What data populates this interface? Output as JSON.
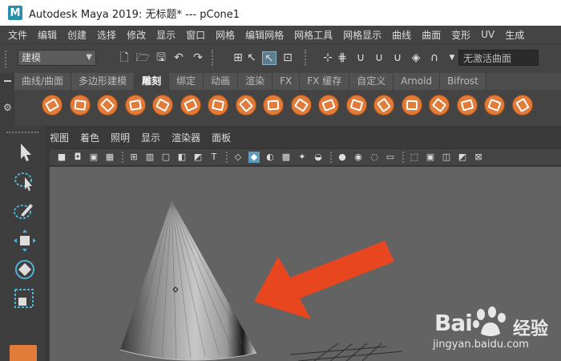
{
  "titlebar": {
    "logo": "M",
    "title": "Autodesk Maya 2019: 无标题*   ---   pCone1"
  },
  "menubar": {
    "items": [
      "文件",
      "编辑",
      "创建",
      "选择",
      "修改",
      "显示",
      "窗口",
      "网格",
      "编辑网格",
      "网格工具",
      "网格显示",
      "曲线",
      "曲面",
      "变形",
      "UV",
      "生成"
    ]
  },
  "statusline": {
    "mode": "建模",
    "live_surface": "无激活曲面",
    "icons": [
      "new-scene-icon",
      "open-scene-icon",
      "save-scene-icon",
      "undo-icon",
      "redo-icon",
      "select-by-hierarchy-icon",
      "select-by-object-icon",
      "select-by-component-icon",
      "snap-to-grid-icon",
      "snap-to-curve-icon",
      "snap-to-point-icon",
      "snap-to-projected-center-icon",
      "snap-to-view-plane-icon",
      "make-live-icon"
    ]
  },
  "shelf": {
    "tabs": [
      "曲线/曲面",
      "多边形建模",
      "雕刻",
      "绑定",
      "动画",
      "渲染",
      "FX",
      "FX 缓存",
      "自定义",
      "Arnold",
      "Bifrost"
    ],
    "active_tab": "雕刻",
    "tool_count_label": "",
    "tools": [
      "sculpt-tool",
      "smooth-tool",
      "relax-tool",
      "grab-tool",
      "pinch-tool",
      "flatten-tool",
      "foamy-tool",
      "spray-tool",
      "repeat-tool",
      "imprint-tool",
      "wax-tool",
      "scrape-tool",
      "fill-tool",
      "knife-tool",
      "smear-tool",
      "bulge-tool",
      "amplify-tool",
      "freeze-tool"
    ]
  },
  "toolbox": {
    "tools": [
      "select-tool-icon",
      "lasso-tool-icon",
      "paint-select-tool-icon",
      "move-tool-icon",
      "rotate-tool-icon",
      "scale-tool-icon"
    ]
  },
  "panel": {
    "menu": [
      "视图",
      "着色",
      "照明",
      "显示",
      "渲染器",
      "面板"
    ]
  },
  "watermark": {
    "brand": "Bai",
    "brand_suffix": "经验",
    "url": "jingyan.baidu.com"
  },
  "colors": {
    "accent": "#e07b39",
    "arrow": "#e8461f",
    "viewport": "#636363"
  }
}
